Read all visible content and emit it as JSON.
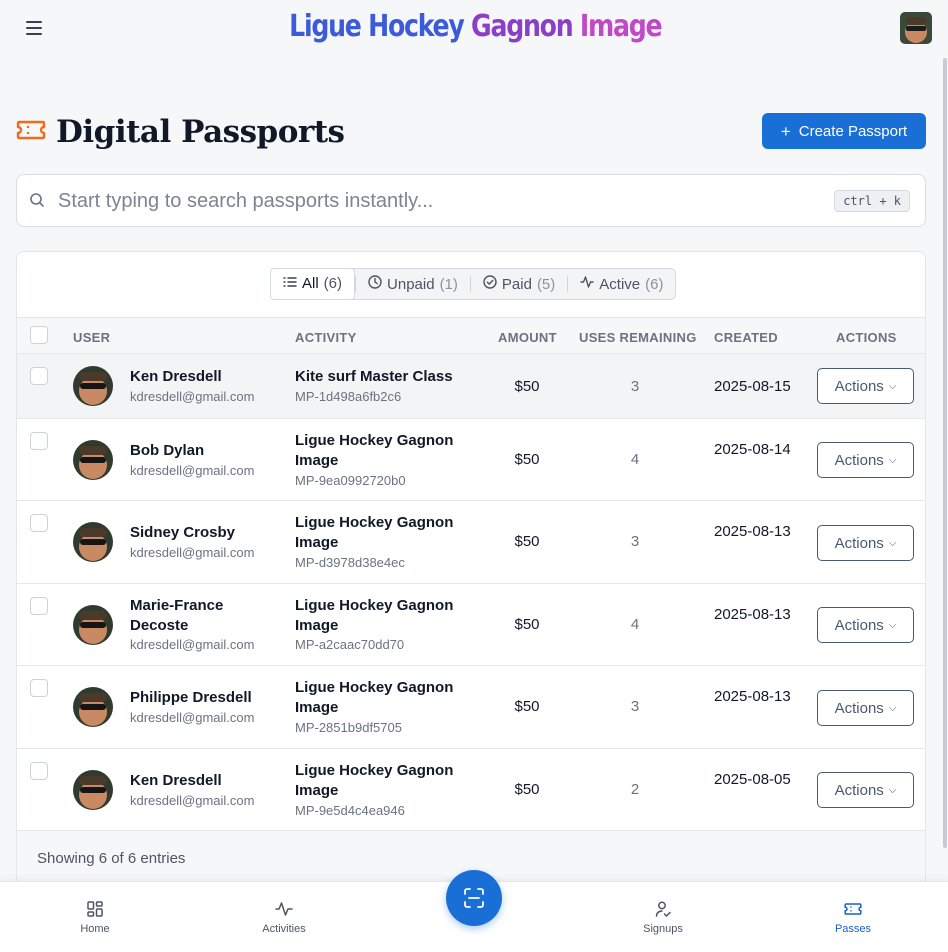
{
  "header": {
    "brand_part1": "Ligue Hockey ",
    "brand_part2": "Gagnon ",
    "brand_part3": "Image",
    "brand_colors": [
      "#3b5bdb",
      "#8b3fc6",
      "#c149c9"
    ]
  },
  "page": {
    "title": "Digital Passports",
    "title_icon": "ticket-icon",
    "accent": "#1a6fd6",
    "create_button_label": "Create Passport"
  },
  "search": {
    "placeholder": "Start typing to search passports instantly...",
    "shortcut": "ctrl + k"
  },
  "filters": [
    {
      "label": "All",
      "count": "(6)",
      "icon": "list-icon",
      "active": true
    },
    {
      "label": "Unpaid",
      "count": "(1)",
      "icon": "clock-icon",
      "active": false
    },
    {
      "label": "Paid",
      "count": "(5)",
      "icon": "check-circle-icon",
      "active": false
    },
    {
      "label": "Active",
      "count": "(6)",
      "icon": "activity-icon",
      "active": false
    }
  ],
  "table": {
    "columns": {
      "user": "USER",
      "activity": "ACTIVITY",
      "amount": "AMOUNT",
      "uses": "USES REMAINING",
      "created": "CREATED",
      "actions": "ACTIONS"
    },
    "action_label": "Actions",
    "rows": [
      {
        "name": "Ken Dresdell",
        "email": "kdresdell@gmail.com",
        "activity": "Kite surf Master Class",
        "code": "MP-1d498a6fb2c6",
        "amount": "$50",
        "uses": "3",
        "created": "2025-08-15"
      },
      {
        "name": "Bob Dylan",
        "email": "kdresdell@gmail.com",
        "activity": "Ligue Hockey Gagnon Image",
        "code": "MP-9ea0992720b0",
        "amount": "$50",
        "uses": "4",
        "created": "2025-08-14"
      },
      {
        "name": "Sidney Crosby",
        "email": "kdresdell@gmail.com",
        "activity": "Ligue Hockey Gagnon Image",
        "code": "MP-d3978d38e4ec",
        "amount": "$50",
        "uses": "3",
        "created": "2025-08-13"
      },
      {
        "name": "Marie-France Decoste",
        "email": "kdresdell@gmail.com",
        "activity": "Ligue Hockey Gagnon Image",
        "code": "MP-a2caac70dd70",
        "amount": "$50",
        "uses": "4",
        "created": "2025-08-13"
      },
      {
        "name": "Philippe Dresdell",
        "email": "kdresdell@gmail.com",
        "activity": "Ligue Hockey Gagnon Image",
        "code": "MP-2851b9df5705",
        "amount": "$50",
        "uses": "3",
        "created": "2025-08-13"
      },
      {
        "name": "Ken Dresdell",
        "email": "kdresdell@gmail.com",
        "activity": "Ligue Hockey Gagnon Image",
        "code": "MP-9e5d4c4ea946",
        "amount": "$50",
        "uses": "2",
        "created": "2025-08-05"
      }
    ],
    "footer": "Showing 6 of 6 entries"
  },
  "bottom_nav": {
    "items": [
      {
        "label": "Home",
        "icon": "grid-icon",
        "active": false
      },
      {
        "label": "Activities",
        "icon": "activity-icon",
        "active": false
      },
      {
        "label": "Signups",
        "icon": "user-check-icon",
        "active": false
      },
      {
        "label": "Passes",
        "icon": "ticket-icon",
        "active": true
      }
    ],
    "fab_icon": "scan-icon"
  }
}
